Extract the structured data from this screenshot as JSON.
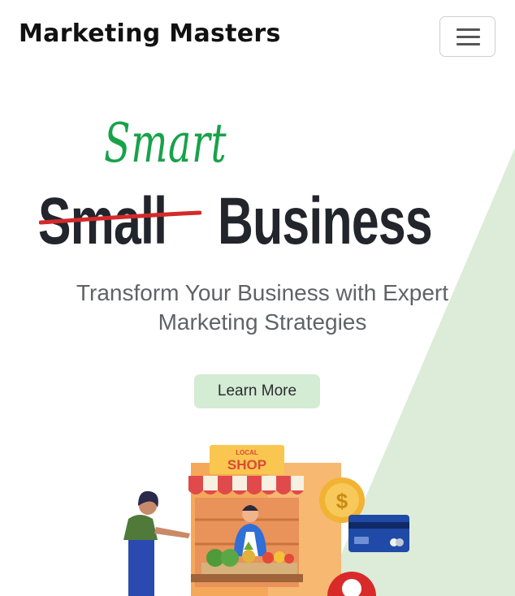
{
  "navbar": {
    "brand": "Marketing Masters",
    "toggler_icon": "hamburger-menu-icon"
  },
  "hero": {
    "handwritten_word": "Smart",
    "struck_word": "Small",
    "main_word": "Business",
    "subtitle": "Transform Your Business with Expert Marketing Strategies",
    "cta_label": "Learn More"
  },
  "illustration": {
    "sign_top": "LOCAL",
    "sign_main": "SHOP",
    "coin_symbol": "$"
  },
  "colors": {
    "accent_green": "#18a24a",
    "strike_red": "#d42a2a",
    "cta_bg": "#d4ebd4",
    "bg_shape": "#dcecd8",
    "heading_dark": "#22252b"
  }
}
